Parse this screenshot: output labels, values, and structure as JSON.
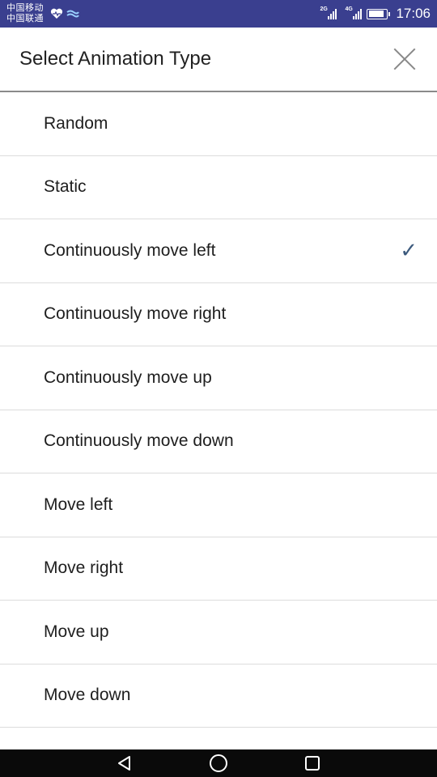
{
  "status_bar": {
    "carrier_1": "中国移动",
    "carrier_2": "中国联通",
    "network_1": "2G",
    "network_2": "4G",
    "battery_level": 0.85,
    "time": "17:06"
  },
  "dialog": {
    "title": "Select Animation Type",
    "selected_index": 2,
    "options": [
      "Random",
      "Static",
      "Continuously move left",
      "Continuously move right",
      "Continuously move up",
      "Continuously move down",
      "Move left",
      "Move right",
      "Move up",
      "Move down"
    ],
    "check_glyph": "✓"
  },
  "colors": {
    "status_bar": "#3a3f8f",
    "check": "#3c5a7d",
    "divider": "#dcdcdc"
  }
}
